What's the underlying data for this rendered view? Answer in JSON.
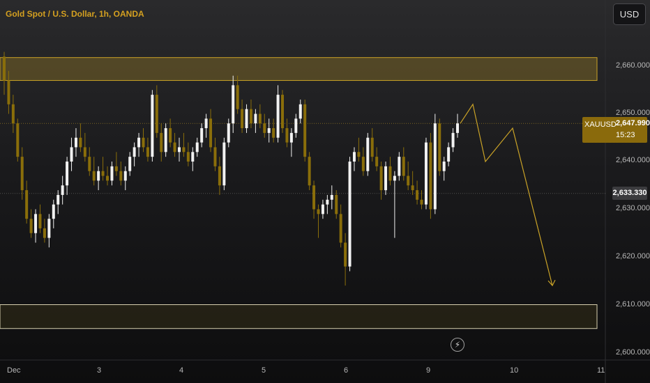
{
  "header": {
    "title": "Gold Spot / U.S. Dollar, 1h, OANDA",
    "currency": "USD"
  },
  "price_tag": {
    "symbol": "XAUUSD",
    "price": "2,647.990",
    "countdown": "15:23"
  },
  "last_price_tag": "2,633.330",
  "flash_icon": "lightning-icon",
  "colors": {
    "up": "#f2f2f2",
    "down": "#8a6e0a",
    "zone": "#c9a227",
    "projection": "#c9a227"
  },
  "chart_data": {
    "type": "candlestick",
    "title": "Gold Spot / U.S. Dollar, 1h, OANDA",
    "yaxis": {
      "ticks": [
        "2,660.000",
        "2,650.000",
        "2,640.000",
        "2,630.000",
        "2,620.000",
        "2,610.000",
        "2,600.000"
      ],
      "ylim": [
        2600,
        2665
      ]
    },
    "xaxis": {
      "ticks": [
        "Dec",
        "3",
        "4",
        "5",
        "6",
        "9",
        "10",
        "11"
      ]
    },
    "candles": [
      [
        2662,
        2663,
        2654,
        2657
      ],
      [
        2657,
        2659,
        2650,
        2652
      ],
      [
        2652,
        2654,
        2646,
        2648
      ],
      [
        2648,
        2649,
        2640,
        2641
      ],
      [
        2641,
        2643,
        2632,
        2634
      ],
      [
        2634,
        2636,
        2627,
        2628
      ],
      [
        2628,
        2630,
        2624,
        2625
      ],
      [
        2625,
        2630,
        2623,
        2629
      ],
      [
        2629,
        2631,
        2625,
        2626
      ],
      [
        2626,
        2628,
        2623,
        2624
      ],
      [
        2624,
        2629,
        2622,
        2628
      ],
      [
        2628,
        2632,
        2626,
        2631
      ],
      [
        2631,
        2634,
        2629,
        2633
      ],
      [
        2633,
        2637,
        2631,
        2635
      ],
      [
        2635,
        2641,
        2633,
        2640
      ],
      [
        2640,
        2645,
        2638,
        2643
      ],
      [
        2643,
        2647,
        2641,
        2645
      ],
      [
        2645,
        2648,
        2642,
        2643
      ],
      [
        2643,
        2646,
        2640,
        2641
      ],
      [
        2641,
        2643,
        2637,
        2638
      ],
      [
        2638,
        2641,
        2635,
        2636
      ],
      [
        2636,
        2639,
        2634,
        2638
      ],
      [
        2638,
        2641,
        2636,
        2637
      ],
      [
        2637,
        2639,
        2635,
        2636
      ],
      [
        2636,
        2640,
        2635,
        2639
      ],
      [
        2639,
        2642,
        2637,
        2638
      ],
      [
        2638,
        2640,
        2635,
        2636
      ],
      [
        2636,
        2639,
        2634,
        2638
      ],
      [
        2638,
        2642,
        2637,
        2641
      ],
      [
        2641,
        2644,
        2639,
        2643
      ],
      [
        2643,
        2646,
        2641,
        2645
      ],
      [
        2645,
        2647,
        2642,
        2643
      ],
      [
        2643,
        2645,
        2640,
        2641
      ],
      [
        2641,
        2655,
        2640,
        2654
      ],
      [
        2654,
        2656,
        2645,
        2646
      ],
      [
        2646,
        2648,
        2640,
        2642
      ],
      [
        2642,
        2648,
        2641,
        2647
      ],
      [
        2647,
        2649,
        2643,
        2644
      ],
      [
        2644,
        2646,
        2641,
        2642
      ],
      [
        2642,
        2645,
        2640,
        2643
      ],
      [
        2643,
        2646,
        2641,
        2642
      ],
      [
        2642,
        2644,
        2639,
        2640
      ],
      [
        2640,
        2643,
        2638,
        2642
      ],
      [
        2642,
        2645,
        2641,
        2644
      ],
      [
        2644,
        2648,
        2643,
        2647
      ],
      [
        2647,
        2650,
        2645,
        2649
      ],
      [
        2649,
        2651,
        2642,
        2643
      ],
      [
        2643,
        2645,
        2638,
        2639
      ],
      [
        2639,
        2641,
        2633,
        2635
      ],
      [
        2635,
        2645,
        2634,
        2644
      ],
      [
        2644,
        2649,
        2643,
        2648
      ],
      [
        2648,
        2658,
        2646,
        2656
      ],
      [
        2656,
        2658,
        2650,
        2651
      ],
      [
        2651,
        2653,
        2646,
        2647
      ],
      [
        2647,
        2652,
        2646,
        2651
      ],
      [
        2651,
        2653,
        2647,
        2648
      ],
      [
        2648,
        2651,
        2646,
        2650
      ],
      [
        2650,
        2652,
        2647,
        2648
      ],
      [
        2648,
        2650,
        2645,
        2646
      ],
      [
        2646,
        2649,
        2644,
        2647
      ],
      [
        2647,
        2649,
        2644,
        2645
      ],
      [
        2645,
        2656,
        2644,
        2654
      ],
      [
        2654,
        2655,
        2646,
        2647
      ],
      [
        2647,
        2649,
        2643,
        2644
      ],
      [
        2644,
        2647,
        2641,
        2646
      ],
      [
        2646,
        2650,
        2645,
        2649
      ],
      [
        2649,
        2653,
        2648,
        2652
      ],
      [
        2652,
        2653,
        2640,
        2641
      ],
      [
        2641,
        2642,
        2634,
        2635
      ],
      [
        2635,
        2636,
        2628,
        2630
      ],
      [
        2630,
        2631,
        2624,
        2629
      ],
      [
        2629,
        2632,
        2628,
        2631
      ],
      [
        2631,
        2633,
        2629,
        2632
      ],
      [
        2632,
        2635,
        2630,
        2633
      ],
      [
        2633,
        2634,
        2628,
        2629
      ],
      [
        2629,
        2631,
        2622,
        2623
      ],
      [
        2623,
        2625,
        2614,
        2618
      ],
      [
        2618,
        2641,
        2617,
        2640
      ],
      [
        2640,
        2643,
        2638,
        2642
      ],
      [
        2642,
        2645,
        2640,
        2641
      ],
      [
        2641,
        2643,
        2637,
        2638
      ],
      [
        2638,
        2646,
        2637,
        2645
      ],
      [
        2645,
        2647,
        2640,
        2641
      ],
      [
        2641,
        2643,
        2638,
        2639
      ],
      [
        2639,
        2640,
        2632,
        2634
      ],
      [
        2634,
        2640,
        2633,
        2639
      ],
      [
        2639,
        2641,
        2635,
        2636
      ],
      [
        2636,
        2638,
        2624,
        2637
      ],
      [
        2637,
        2642,
        2636,
        2641
      ],
      [
        2641,
        2643,
        2636,
        2637
      ],
      [
        2637,
        2640,
        2634,
        2635
      ],
      [
        2635,
        2638,
        2633,
        2634
      ],
      [
        2634,
        2636,
        2631,
        2632
      ],
      [
        2632,
        2634,
        2630,
        2631
      ],
      [
        2631,
        2645,
        2630,
        2644
      ],
      [
        2644,
        2646,
        2628,
        2630
      ],
      [
        2630,
        2650,
        2629,
        2648
      ],
      [
        2648,
        2649,
        2637,
        2638
      ],
      [
        2638,
        2641,
        2636,
        2640
      ],
      [
        2640,
        2644,
        2639,
        2643
      ],
      [
        2643,
        2647,
        2642,
        2646
      ],
      [
        2646,
        2650,
        2645,
        2648
      ]
    ],
    "zones": [
      {
        "top": 2661.8,
        "bottom": 2657.0,
        "from": 0,
        "to": 1.0
      },
      {
        "top": 2610.0,
        "bottom": 2605.0,
        "from": 0,
        "to": 1.0
      }
    ],
    "projection_path": [
      [
        2648,
        2648
      ],
      [
        2652,
        2652
      ],
      [
        2640,
        2640
      ],
      [
        2647,
        2647
      ],
      [
        2614,
        2614
      ]
    ],
    "horizontal_lines": [
      2647.99,
      2633.33
    ]
  }
}
